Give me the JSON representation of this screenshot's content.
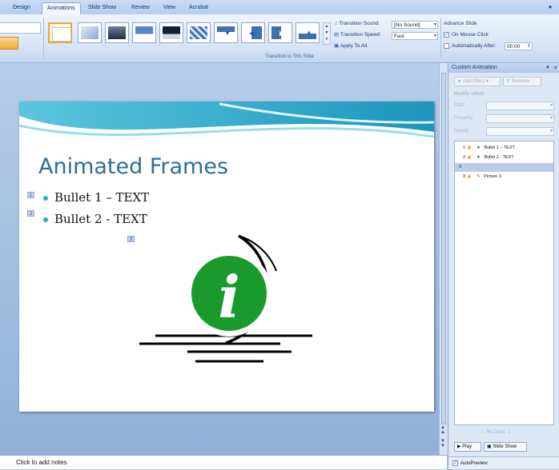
{
  "tabs": [
    {
      "label": "Design"
    },
    {
      "label": "Animations"
    },
    {
      "label": "Slide Show"
    },
    {
      "label": "Review"
    },
    {
      "label": "View"
    },
    {
      "label": "Acrobat"
    }
  ],
  "ribbon": {
    "group_label": "Transition to This Slide",
    "transition_sound_label": "Transition Sound:",
    "transition_sound_value": "[No Sound]",
    "transition_speed_label": "Transition Speed:",
    "transition_speed_value": "Fast",
    "apply_to_all_label": "Apply To All",
    "advance_slide_title": "Advance Slide",
    "on_mouse_click_label": "On Mouse Click",
    "on_mouse_click_checked": true,
    "automatically_after_label": "Automatically After:",
    "automatically_after_value": "00:00"
  },
  "slide": {
    "title": "Animated Frames",
    "bullets": [
      "Bullet 1 – TEXT",
      "Bullet 2 - TEXT"
    ],
    "tags": [
      "1",
      "2",
      "3"
    ],
    "info_glyph": "i",
    "accent_color": "#1a9a2c"
  },
  "notes": {
    "placeholder": "Click to add notes"
  },
  "pane": {
    "title": "Custom Animation",
    "add_effect": "Add Effect",
    "remove": "Remove",
    "modify_effect": "Modify effect",
    "start_label": "Start:",
    "property_label": "Property:",
    "speed_label": "Speed:",
    "items": [
      {
        "num": "1",
        "label": "Bullet 1 – TEXT"
      },
      {
        "num": "2",
        "label": "Bullet 2 - TEXT"
      },
      {
        "num": "3",
        "label": ""
      },
      {
        "num": "3",
        "label": "Picture 3"
      }
    ],
    "reorder": "Re-Order",
    "play": "Play",
    "slide_show": "Slide Show",
    "autopreview": "AutoPreview"
  }
}
